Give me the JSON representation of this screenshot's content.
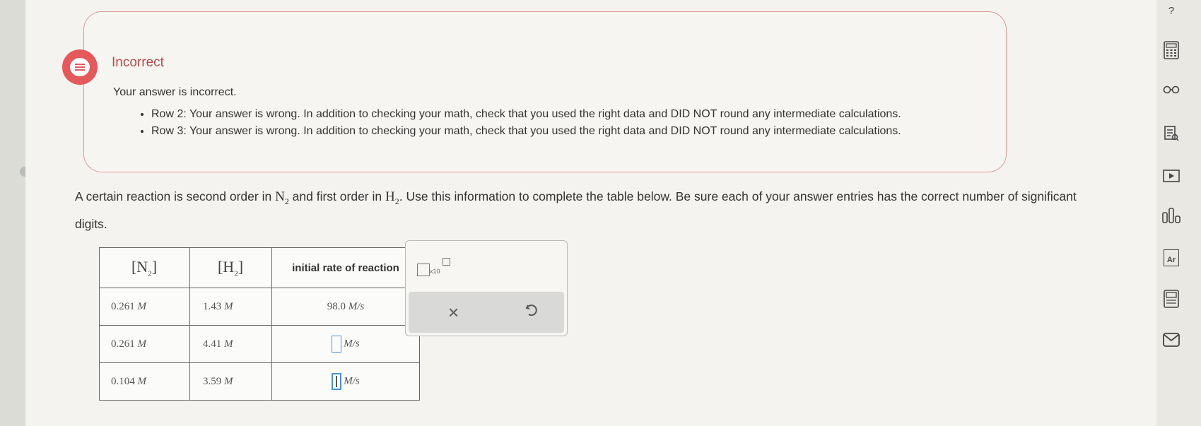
{
  "feedback": {
    "title": "Incorrect",
    "subtitle": "Your answer is incorrect.",
    "items": [
      "Row 2: Your answer is wrong. In addition to checking your math, check that you used the right data and DID NOT round any intermediate calculations.",
      "Row 3: Your answer is wrong. In addition to checking your math, check that you used the right data and DID NOT round any intermediate calculations."
    ]
  },
  "question": {
    "part1": "A certain reaction is second order in ",
    "part2": " and first order in ",
    "part3": ". Use this information to complete the table below. Be sure each of your answer entries has the correct number of significant digits.",
    "species1": "N",
    "species1_sub": "2",
    "species2": "H",
    "species2_sub": "2"
  },
  "table": {
    "headers": {
      "n2": "N",
      "n2_sub": "2",
      "h2": "H",
      "h2_sub": "2",
      "rate": "initial rate of reaction"
    },
    "rows": [
      {
        "n2": "0.261",
        "h2": "1.43",
        "unit": "M",
        "rate": "98.0",
        "rate_unit": "M/s"
      },
      {
        "n2": "0.261",
        "h2": "4.41",
        "unit": "M",
        "rate": "",
        "rate_unit": "M/s"
      },
      {
        "n2": "0.104",
        "h2": "3.59",
        "unit": "M",
        "rate": "",
        "rate_unit": "M/s"
      }
    ]
  },
  "palette": {
    "sci_label": "x10",
    "clear_symbol": "×"
  },
  "toolbar": {
    "help": "?",
    "reference": "Ar"
  },
  "colors": {
    "error_red": "#e4595b",
    "feedback_border": "#d99a96",
    "input_blue": "#4a90d9"
  }
}
